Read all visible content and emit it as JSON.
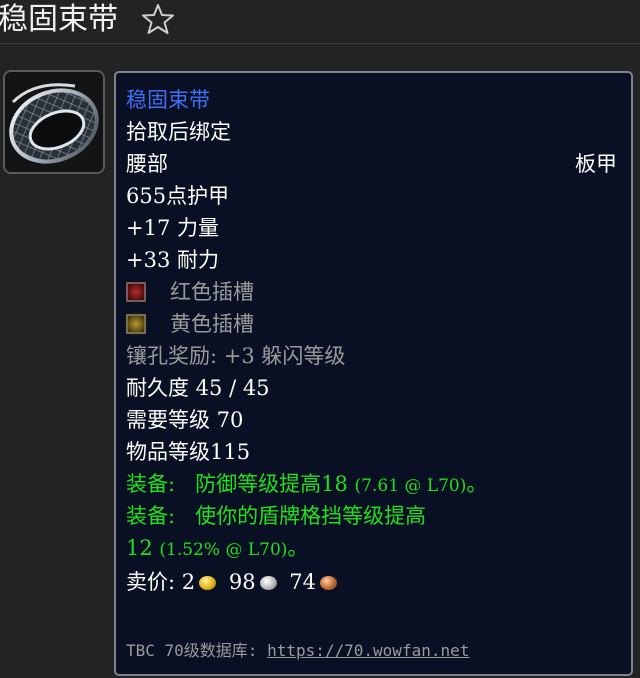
{
  "header": {
    "title": "稳固束带",
    "favorite_icon": "star-outline-icon"
  },
  "item_icon": "belt-icon",
  "tooltip": {
    "name": "稳固束带",
    "binding": "拾取后绑定",
    "slot": "腰部",
    "armor_type": "板甲",
    "armor": "655点护甲",
    "stats": [
      {
        "value": "+17",
        "name": "力量"
      },
      {
        "value": "+33",
        "name": "耐力"
      }
    ],
    "sockets": [
      {
        "color": "red",
        "label": "红色插槽"
      },
      {
        "color": "yellow",
        "label": "黄色插槽"
      }
    ],
    "socket_bonus": "镶孔奖励: +3 躲闪等级",
    "durability": "耐久度 45 / 45",
    "required_level": "需要等级 70",
    "item_level": "物品等级115",
    "equip_effects": [
      {
        "prefix": "装备:",
        "text": "防御等级提高18",
        "note": "(7.61 @ L70)",
        "tail": "。"
      },
      {
        "prefix": "装备:",
        "text": "使你的盾牌格挡等级提高",
        "text2": "12",
        "note": "(1.52% @ L70)",
        "tail": "。"
      }
    ],
    "sell_price": {
      "label": "卖价:",
      "gold": "2",
      "silver": "98",
      "copper": "74"
    },
    "footer": {
      "prefix": "TBC 70级数据库:",
      "link": "https://70.wowfan.net"
    }
  },
  "colors": {
    "item_name": "#3d6ff7",
    "equip_green": "#1ee01e",
    "gray_text": "#9a9a9a",
    "tooltip_bg": "#0a1024"
  }
}
